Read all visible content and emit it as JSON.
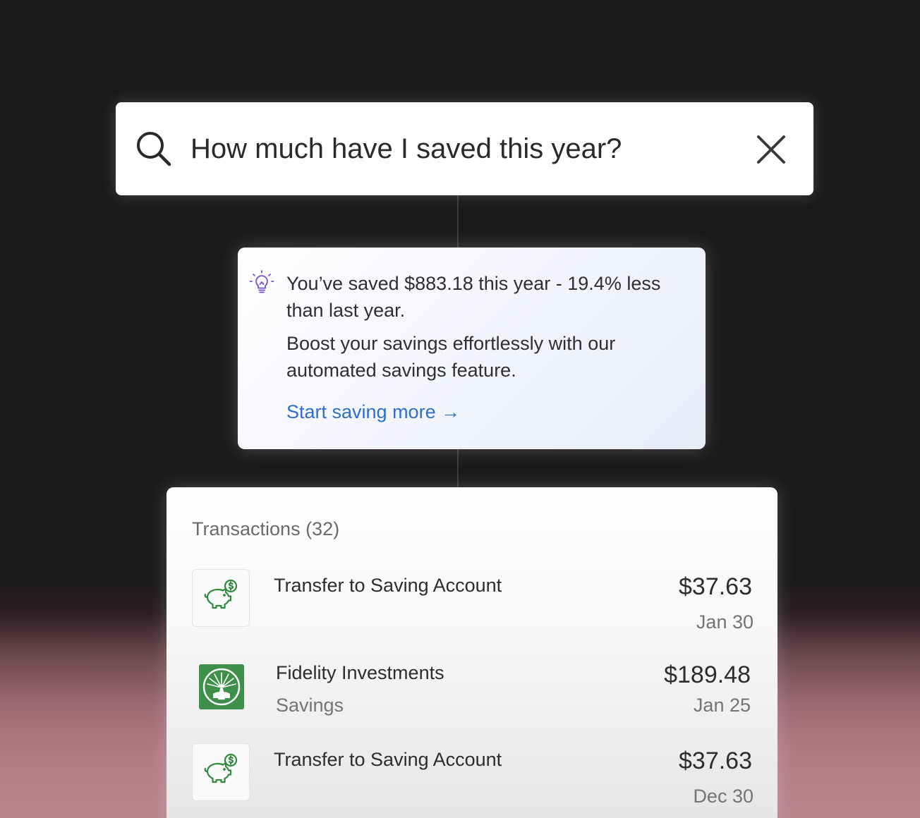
{
  "search": {
    "query": "How much have I saved this year?",
    "search_icon": "search-icon",
    "clear_icon": "close-icon"
  },
  "insight": {
    "icon": "lightbulb-icon",
    "summary": "You’ve saved $883.18 this year - 19.4% less than last year.",
    "suggestion": "Boost your savings effortlessly with our automated savings feature.",
    "cta": "Start saving more →",
    "accent_color": "#2f6fc5"
  },
  "transactions": {
    "header": "Transactions (32)",
    "items": [
      {
        "icon": "piggy-bank-icon",
        "name": "Transfer to Saving Account",
        "sub": "",
        "amount": "$37.63",
        "date": "Jan 30"
      },
      {
        "icon": "fidelity-logo",
        "name": "Fidelity Investments",
        "sub": "Savings",
        "amount": "$189.48",
        "date": "Jan 25"
      },
      {
        "icon": "piggy-bank-icon",
        "name": "Transfer to Saving Account",
        "sub": "",
        "amount": "$37.63",
        "date": "Dec 30"
      }
    ]
  },
  "colors": {
    "background": "#1b1a1a",
    "bottom_glow": "#b98690",
    "piggy_green": "#2f8a3f",
    "fidelity_green": "#3d8f4a",
    "bulb_purple": "#7b4fc9"
  }
}
